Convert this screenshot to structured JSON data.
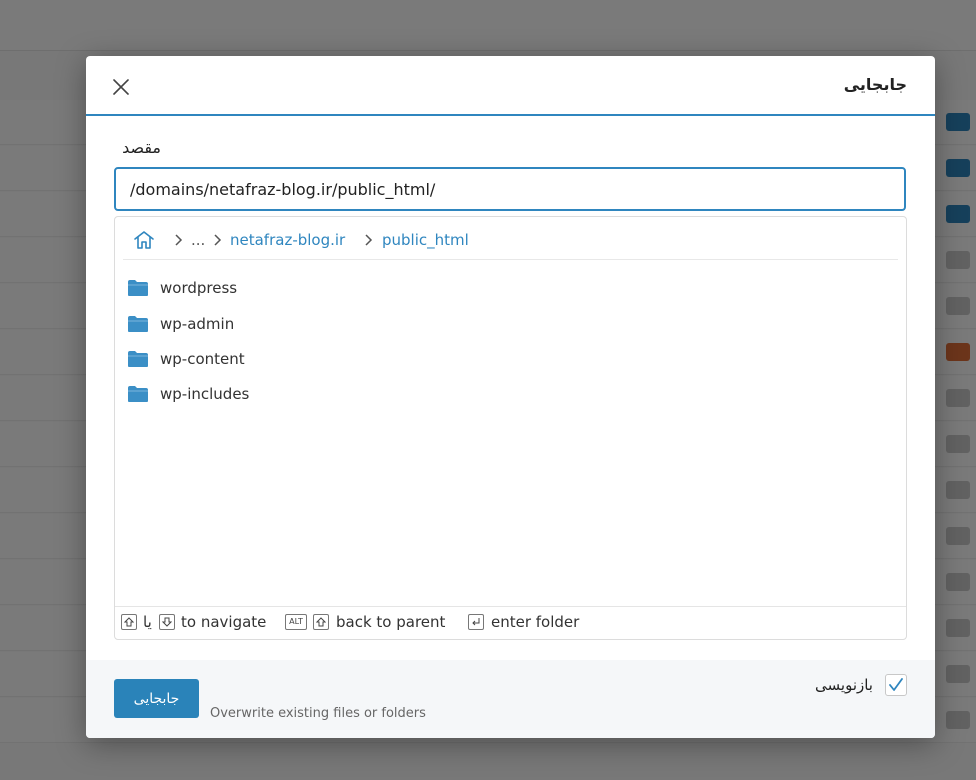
{
  "dialog": {
    "title": "جابجایی",
    "destination_label": "مقصد",
    "destination_value": "/domains/netafraz-blog.ir/public_html/",
    "breadcrumb": {
      "ellipsis": "...",
      "items": [
        "netafraz-blog.ir",
        "public_html"
      ]
    },
    "folders": [
      "wordpress",
      "wp-admin",
      "wp-content",
      "wp-includes"
    ],
    "hints": {
      "or": "یا",
      "navigate": "to navigate",
      "alt_key": "ALT",
      "back": "back to parent",
      "enter": "enter folder"
    },
    "overwrite_label": "بازنویسی",
    "overwrite_checked": true,
    "overwrite_hint": "Overwrite existing files or folders",
    "move_button": "جابجایی"
  },
  "colors": {
    "accent": "#2f86bf",
    "button": "#2a83b9"
  },
  "icons": [
    "close-icon",
    "home-icon",
    "chevron-right-icon",
    "folder-icon",
    "arrow-up-key-icon",
    "arrow-down-key-icon",
    "enter-key-icon",
    "check-icon"
  ]
}
